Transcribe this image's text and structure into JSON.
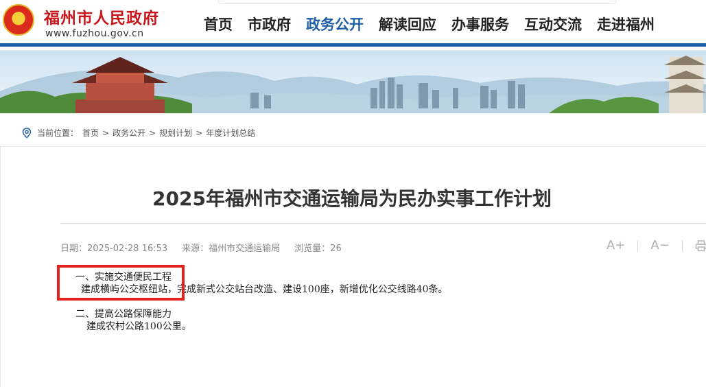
{
  "header": {
    "site_name": "福州市人民政府",
    "site_url": "www.fuzhou.gov.cn",
    "nav": [
      {
        "label": "首页",
        "active": false
      },
      {
        "label": "市政府",
        "active": false
      },
      {
        "label": "政务公开",
        "active": true
      },
      {
        "label": "解读回应",
        "active": false
      },
      {
        "label": "互动交流",
        "active": false
      },
      {
        "label": "办事服务",
        "active": false
      },
      {
        "label": "走进福州",
        "active": false
      }
    ]
  },
  "breadcrumb": {
    "label": "当前位置：",
    "items": [
      "首页",
      "政务公开",
      "规划计划",
      "年度计划总结"
    ],
    "separator": ">"
  },
  "article": {
    "title": "2025年福州市交通运输局为民办实事工作计划",
    "date": "日期：2025-02-28 16:53",
    "source": "来源：福州市交通运输局",
    "views": "浏览量：26",
    "tools": {
      "font_larger": "A+",
      "font_smaller": "A−"
    },
    "sections": [
      {
        "heading": "一、实施交通便民工程",
        "body": "建成横屿公交枢纽站，完成新式公交站台改造、建设100座，新增优化公交线路40条。"
      },
      {
        "heading": "二、提高公路保障能力",
        "body": "建成农村公路100公里。"
      }
    ]
  },
  "colors": {
    "brand_red": "#c8161d",
    "nav_active": "#1f5fa8",
    "highlight": "#e3211f"
  }
}
